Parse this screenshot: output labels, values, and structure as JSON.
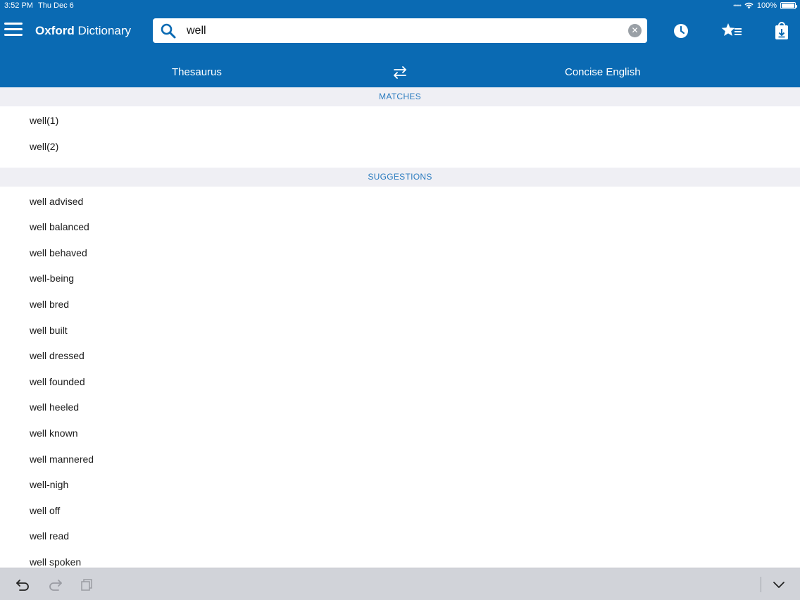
{
  "status_bar": {
    "time": "3:52 PM",
    "date": "Thu Dec 6",
    "battery": "100%"
  },
  "header": {
    "title_bold": "Oxford",
    "title_rest": "Dictionary",
    "icons": [
      "menu-icon",
      "clock-icon",
      "favorites-icon",
      "download-icon"
    ]
  },
  "search": {
    "value": "well",
    "placeholder": ""
  },
  "tabs": {
    "left": "Thesaurus",
    "right": "Concise English"
  },
  "matches": {
    "header": "MATCHES",
    "items": [
      "well(1)",
      "well(2)"
    ]
  },
  "suggestions": {
    "header": "SUGGESTIONS",
    "items": [
      "well advised",
      "well balanced",
      "well behaved",
      "well-being",
      "well bred",
      "well built",
      "well dressed",
      "well founded",
      "well heeled",
      "well known",
      "well mannered",
      "well-nigh",
      "well off",
      "well read",
      "well spoken"
    ]
  },
  "colors": {
    "primary": "#0a6ab3",
    "section_bg": "#efeff4",
    "section_text": "#2a7bbf"
  }
}
